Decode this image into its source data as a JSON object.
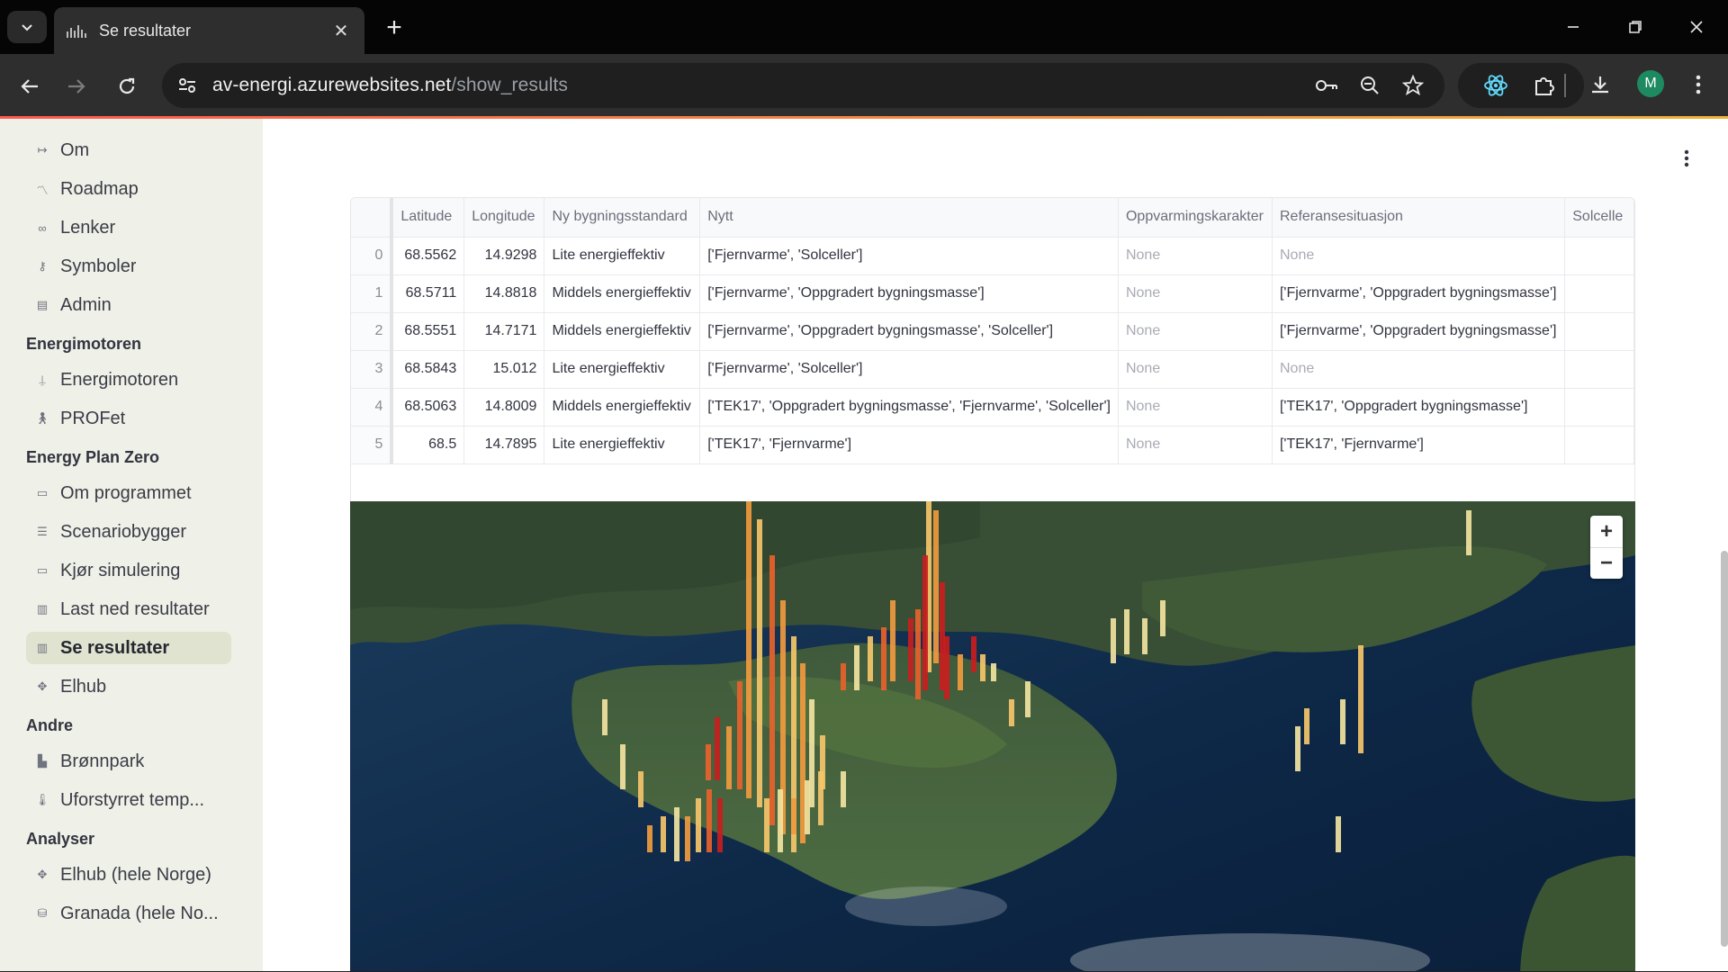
{
  "browser": {
    "tab_title": "Se resultater",
    "url_host": "av-energi.azurewebsites.net",
    "url_path": "/show_results",
    "avatar_letter": "M",
    "accent_colors": [
      "#ff5a4e",
      "#f0b23a"
    ]
  },
  "sidebar": {
    "items_top": [
      {
        "label": "Om",
        "icon": "arrow-right-icon"
      },
      {
        "label": "Roadmap",
        "icon": "trend-icon"
      },
      {
        "label": "Lenker",
        "icon": "link-icon"
      },
      {
        "label": "Symboler",
        "icon": "key-icon"
      },
      {
        "label": "Admin",
        "icon": "building-icon"
      }
    ],
    "sections": [
      {
        "title": "Energimotoren",
        "items": [
          {
            "label": "Energimotoren",
            "icon": "tower-icon"
          },
          {
            "label": "PROFet",
            "icon": "walk-icon"
          }
        ]
      },
      {
        "title": "Energy Plan Zero",
        "items": [
          {
            "label": "Om programmet",
            "icon": "window-icon"
          },
          {
            "label": "Scenariobygger",
            "icon": "list-icon"
          },
          {
            "label": "Kjør simulering",
            "icon": "laptop-icon"
          },
          {
            "label": "Last ned resultater",
            "icon": "chart-icon"
          },
          {
            "label": "Se resultater",
            "icon": "chart-icon",
            "active": true
          },
          {
            "label": "Elhub",
            "icon": "hub-icon"
          }
        ]
      },
      {
        "title": "Andre",
        "items": [
          {
            "label": "Brønnpark",
            "icon": "factory-icon"
          },
          {
            "label": "Uforstyrret temp...",
            "icon": "thermometer-icon"
          }
        ]
      },
      {
        "title": "Analyser",
        "items": [
          {
            "label": "Elhub (hele Norge)",
            "icon": "hub-icon"
          },
          {
            "label": "Granada (hele No...",
            "icon": "database-icon"
          }
        ]
      }
    ]
  },
  "table": {
    "columns": [
      "",
      "Latitude",
      "Longitude",
      "Ny bygningsstandard",
      "Nytt",
      "Oppvarmingskarakter",
      "Referansesituasjon",
      "Solcelle"
    ],
    "rows": [
      [
        "0",
        "68.5562",
        "14.9298",
        "Lite energieffektiv",
        "['Fjernvarme', 'Solceller']",
        "None",
        "None",
        ""
      ],
      [
        "1",
        "68.5711",
        "14.8818",
        "Middels energieffektiv",
        "['Fjernvarme', 'Oppgradert bygningsmasse']",
        "None",
        "['Fjernvarme', 'Oppgradert bygningsmasse']",
        ""
      ],
      [
        "2",
        "68.5551",
        "14.7171",
        "Middels energieffektiv",
        "['Fjernvarme', 'Oppgradert bygningsmasse', 'Solceller']",
        "None",
        "['Fjernvarme', 'Oppgradert bygningsmasse']",
        ""
      ],
      [
        "3",
        "68.5843",
        "15.012",
        "Lite energieffektiv",
        "['Fjernvarme', 'Solceller']",
        "None",
        "None",
        ""
      ],
      [
        "4",
        "68.5063",
        "14.8009",
        "Middels energieffektiv",
        "['TEK17', 'Oppgradert bygningsmasse', 'Fjernvarme', 'Solceller']",
        "None",
        "['TEK17', 'Oppgradert bygningsmasse']",
        ""
      ],
      [
        "5",
        "68.5",
        "14.7895",
        "Lite energieffektiv",
        "['TEK17', 'Fjernvarme']",
        "None",
        "['TEK17', 'Fjernvarme']",
        ""
      ]
    ]
  },
  "map": {
    "zoom_in": "+",
    "zoom_out": "−",
    "bar_colors": [
      "#f2e3a0",
      "#f5c56a",
      "#f09a3e",
      "#e8622b",
      "#c81e1e"
    ]
  }
}
